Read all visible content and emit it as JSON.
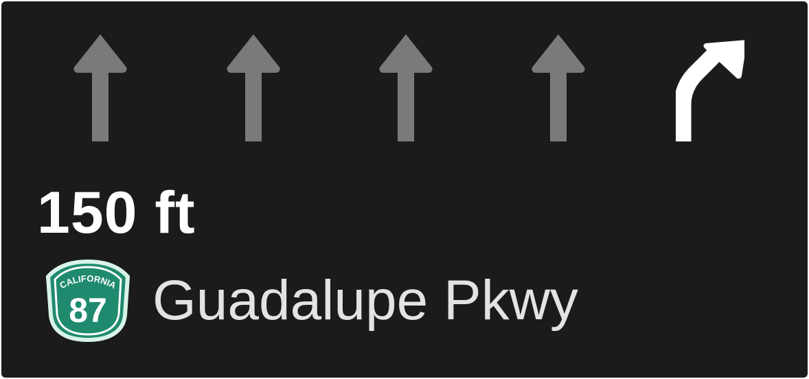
{
  "lane_guidance": {
    "lanes": [
      {
        "icon": "straight-arrow-icon",
        "active": false,
        "color": "#7a7a7a"
      },
      {
        "icon": "straight-arrow-icon",
        "active": false,
        "color": "#7a7a7a"
      },
      {
        "icon": "straight-arrow-icon",
        "active": false,
        "color": "#7a7a7a"
      },
      {
        "icon": "straight-arrow-icon",
        "active": false,
        "color": "#7a7a7a"
      },
      {
        "icon": "slight-right-arrow-icon",
        "active": true,
        "color": "#ffffff"
      }
    ]
  },
  "maneuver": {
    "distance": "150 ft",
    "street_name": "Guadalupe Pkwy",
    "route_shield": {
      "state": "CALIFORNIA",
      "number": "87",
      "color": "#1f8a6e"
    }
  },
  "colors": {
    "background": "#1b1b1b",
    "distance_text": "#ffffff",
    "street_text": "#e3e3e3"
  }
}
